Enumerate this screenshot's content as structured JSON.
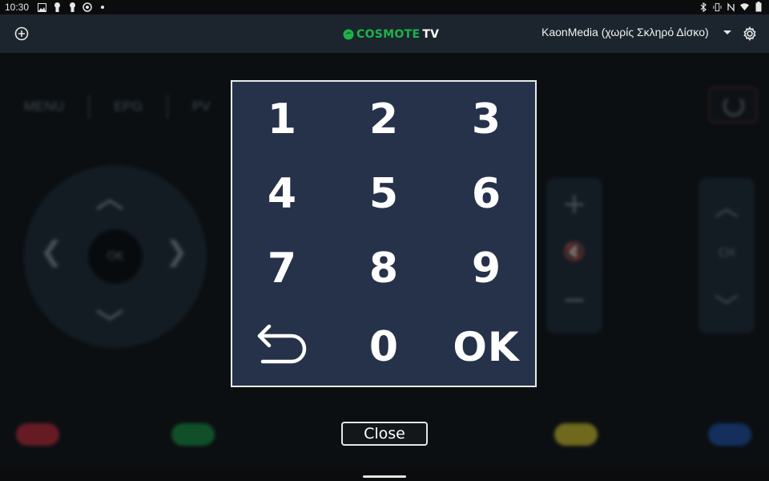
{
  "status_bar": {
    "time": "10:30",
    "left_icons": [
      "image-icon",
      "keyhole-icon",
      "keyhole-icon",
      "location-icon",
      "dot-icon"
    ],
    "right_icons": [
      "bluetooth-icon",
      "vibrate-icon",
      "nfc-icon",
      "wifi-icon",
      "battery-icon"
    ]
  },
  "app_bar": {
    "add_icon": "add-circle-icon",
    "logo_brand": "COSMOTE",
    "logo_suffix": "TV",
    "device_label": "KaonMedia (χωρίς Σκληρό Δίσκο)",
    "settings_icon": "gear-icon",
    "colors": {
      "background": "#1c252d",
      "logo_green": "#1db34a"
    }
  },
  "remote_background": {
    "top_buttons": [
      "MENU",
      "EPG",
      "PV"
    ],
    "ok_label": "OK",
    "ch_label": "CH",
    "color_buttons": [
      "#b12634",
      "#16853a",
      "#c2b227",
      "#1c4a9a"
    ]
  },
  "keypad": {
    "keys": [
      "1",
      "2",
      "3",
      "4",
      "5",
      "6",
      "7",
      "8",
      "9",
      "back",
      "0",
      "OK"
    ],
    "back_icon": "back-arrow-icon",
    "colors": {
      "background": "#26324a",
      "border": "#e9ecef"
    }
  },
  "close_button": {
    "label": "Close"
  }
}
